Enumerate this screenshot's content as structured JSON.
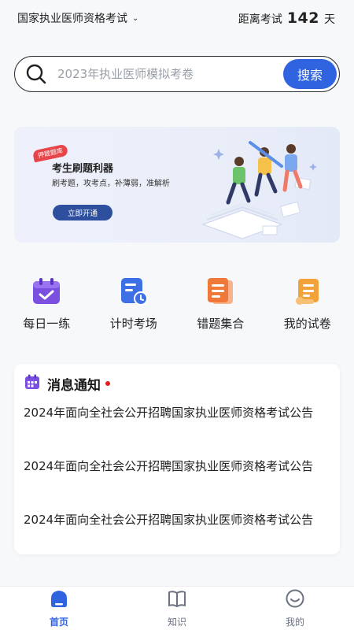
{
  "header": {
    "exam_name": "国家执业医师资格考试",
    "countdown_label": "距离考试",
    "countdown_days": "142",
    "countdown_unit": "天"
  },
  "search": {
    "placeholder": "2023年执业医师模拟考卷",
    "button_label": "搜索"
  },
  "banner": {
    "tag": "押题题库",
    "title": "考生刷题利器",
    "subtitle": "刷考题，攻考点，补薄弱，准解析",
    "button_label": "立即开通"
  },
  "actions": [
    {
      "label": "每日一练",
      "icon": "calendar-check-icon",
      "color": "#7b4fe0"
    },
    {
      "label": "计时考场",
      "icon": "timer-doc-icon",
      "color": "#3d6fe6"
    },
    {
      "label": "错题集合",
      "icon": "wrong-notes-icon",
      "color": "#f07838"
    },
    {
      "label": "我的试卷",
      "icon": "scroll-paper-icon",
      "color": "#f2a23a"
    }
  ],
  "notice": {
    "title": "消息通知",
    "items": [
      "2024年面向全社会公开招聘国家执业医师资格考试公告",
      "2024年面向全社会公开招聘国家执业医师资格考试公告",
      "2024年面向全社会公开招聘国家执业医师资格考试公告"
    ]
  },
  "tabs": [
    {
      "label": "首页",
      "active": true
    },
    {
      "label": "知识",
      "active": false
    },
    {
      "label": "我的",
      "active": false
    }
  ],
  "colors": {
    "accent": "#2f63e0",
    "notice_dot": "#e02020"
  }
}
